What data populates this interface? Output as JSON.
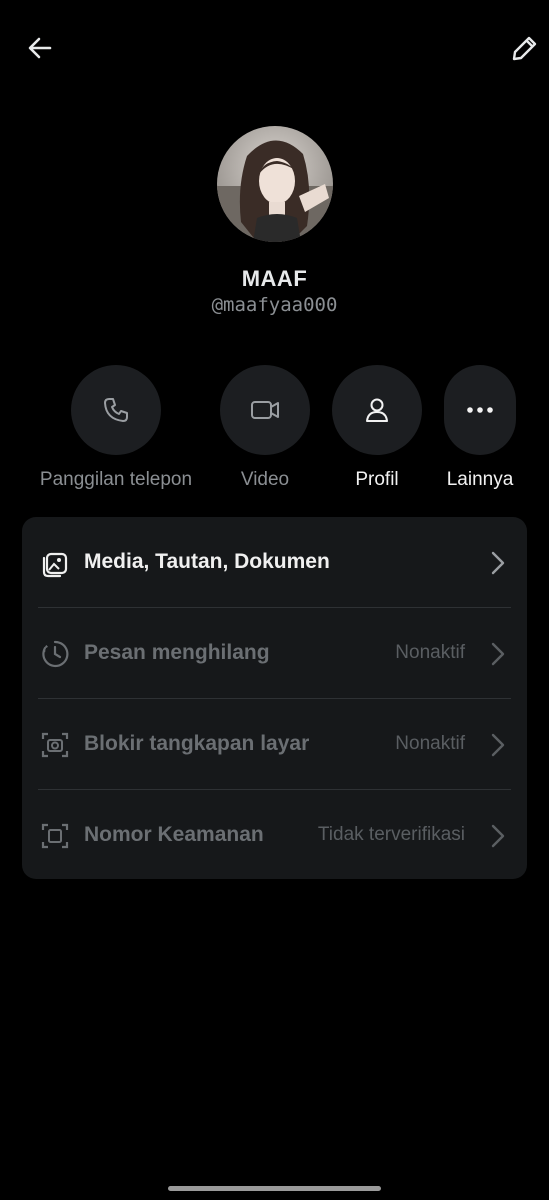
{
  "header": {
    "back_icon": "arrow-left-icon",
    "edit_icon": "pencil-icon"
  },
  "profile": {
    "name": "MAAF",
    "handle": "@maafyaa000"
  },
  "actions": [
    {
      "label": "Panggilan telepon",
      "icon": "phone-icon"
    },
    {
      "label": "Video",
      "icon": "video-camera-icon"
    },
    {
      "label": "Profil",
      "icon": "person-icon"
    },
    {
      "label": "Lainnya",
      "icon": "more-dots-icon"
    }
  ],
  "settings": [
    {
      "label": "Media, Tautan, Dokumen",
      "value": "",
      "icon": "media-gallery-icon"
    },
    {
      "label": "Pesan menghilang",
      "value": "Nonaktif",
      "icon": "timer-icon"
    },
    {
      "label": "Blokir tangkapan layar",
      "value": "Nonaktif",
      "icon": "screenshot-block-icon"
    },
    {
      "label": "Nomor Keamanan",
      "value": "Tidak terverifikasi",
      "icon": "security-number-icon"
    }
  ],
  "colors": {
    "background": "#000000",
    "card": "#16181a",
    "circle": "#1c1e21",
    "muted_text": "#8b8f93"
  }
}
